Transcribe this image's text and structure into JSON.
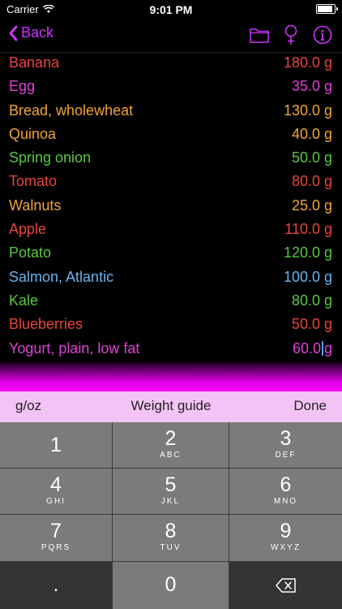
{
  "status_bar": {
    "carrier": "Carrier",
    "time": "9:01 PM"
  },
  "nav": {
    "back_label": "Back",
    "icons": [
      "folder-icon",
      "female-symbol-icon",
      "info-icon"
    ],
    "accent_color": "#cc33ff"
  },
  "foods": [
    {
      "name": "Banana",
      "weight": "180.0 g",
      "color": "#e8463a"
    },
    {
      "name": "Egg",
      "weight": "35.0 g",
      "color": "#e040d8"
    },
    {
      "name": "Bread, wholewheat",
      "weight": "130.0 g",
      "color": "#f0a530"
    },
    {
      "name": "Quinoa",
      "weight": "40.0 g",
      "color": "#f0a530"
    },
    {
      "name": "Spring onion",
      "weight": "50.0 g",
      "color": "#58c840"
    },
    {
      "name": "Tomato",
      "weight": "80.0 g",
      "color": "#e8463a"
    },
    {
      "name": "Walnuts",
      "weight": "25.0 g",
      "color": "#f0a530"
    },
    {
      "name": "Apple",
      "weight": "110.0 g",
      "color": "#e8463a"
    },
    {
      "name": "Potato",
      "weight": "120.0 g",
      "color": "#58c840"
    },
    {
      "name": "Salmon, Atlantic",
      "weight": "100.0 g",
      "color": "#6ab2f0"
    },
    {
      "name": "Kale",
      "weight": "80.0 g",
      "color": "#58c840"
    },
    {
      "name": "Blueberries",
      "weight": "50.0 g",
      "color": "#e8463a"
    },
    {
      "name": "Yogurt, plain, low fat",
      "weight_value": "60.0",
      "weight_unit": "g",
      "color": "#e040d8",
      "editing": true
    }
  ],
  "toolbar": {
    "units_label": "g/oz",
    "guide_label": "Weight guide",
    "done_label": "Done"
  },
  "keypad": {
    "keys": [
      {
        "digit": "1",
        "letters": ""
      },
      {
        "digit": "2",
        "letters": "ABC"
      },
      {
        "digit": "3",
        "letters": "DEF"
      },
      {
        "digit": "4",
        "letters": "GHI"
      },
      {
        "digit": "5",
        "letters": "JKL"
      },
      {
        "digit": "6",
        "letters": "MNO"
      },
      {
        "digit": "7",
        "letters": "PQRS"
      },
      {
        "digit": "8",
        "letters": "TUV"
      },
      {
        "digit": "9",
        "letters": "WXYZ"
      },
      {
        "digit": ".",
        "letters": ""
      },
      {
        "digit": "0",
        "letters": ""
      },
      {
        "digit": "",
        "letters": "",
        "icon": "backspace-icon"
      }
    ]
  }
}
